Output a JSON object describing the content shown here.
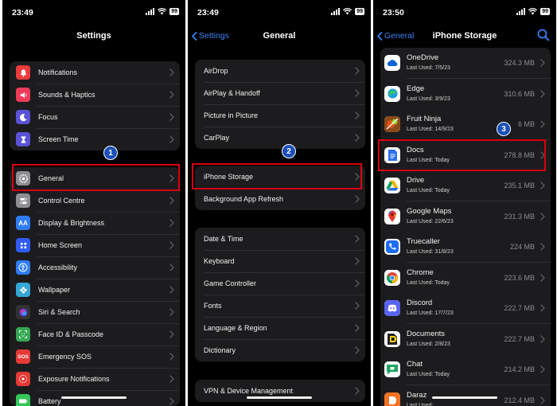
{
  "colors": {
    "accent": "#3a82f7",
    "highlight": "#d9000f",
    "badge": "#1b50b9"
  },
  "panel1": {
    "time": "23:49",
    "battery": "99",
    "title": "Settings",
    "group1": [
      {
        "label": "Notifications",
        "icon": "bell-icon",
        "color": "#ee3b3b"
      },
      {
        "label": "Sounds & Haptics",
        "icon": "speaker-icon",
        "color": "#ee3b5a"
      },
      {
        "label": "Focus",
        "icon": "moon-icon",
        "color": "#5a53d6"
      },
      {
        "label": "Screen Time",
        "icon": "hourglass-icon",
        "color": "#5a53d6"
      }
    ],
    "group2": [
      {
        "label": "General",
        "icon": "gear-icon",
        "color": "#8e8e93"
      },
      {
        "label": "Control Centre",
        "icon": "toggles-icon",
        "color": "#8e8e93"
      },
      {
        "label": "Display & Brightness",
        "icon": "aa-icon",
        "color": "#2f7cf6"
      },
      {
        "label": "Home Screen",
        "icon": "grid-icon",
        "color": "#2f5cf6"
      },
      {
        "label": "Accessibility",
        "icon": "accessibility-icon",
        "color": "#2f7cf6"
      },
      {
        "label": "Wallpaper",
        "icon": "flower-icon",
        "color": "#35a7d6"
      },
      {
        "label": "Siri & Search",
        "icon": "siri-icon",
        "color": "#333333"
      },
      {
        "label": "Face ID & Passcode",
        "icon": "face-id-icon",
        "color": "#34a853"
      },
      {
        "label": "Emergency SOS",
        "icon": "sos-icon",
        "color": "#e53935"
      },
      {
        "label": "Exposure Notifications",
        "icon": "exposure-icon",
        "color": "#e53935"
      },
      {
        "label": "Battery",
        "icon": "battery-icon",
        "color": "#34c759"
      }
    ],
    "step": "1"
  },
  "panel2": {
    "time": "23:49",
    "battery": "99",
    "back": "Settings",
    "title": "General",
    "group1": [
      "AirDrop",
      "AirPlay & Handoff",
      "Picture in Picture",
      "CarPlay"
    ],
    "group2": [
      "iPhone Storage",
      "Background App Refresh"
    ],
    "group3": [
      "Date & Time",
      "Keyboard",
      "Game Controller",
      "Fonts",
      "Language & Region",
      "Dictionary"
    ],
    "group4": [
      "VPN & Device Management"
    ],
    "step": "2"
  },
  "panel3": {
    "time": "23:50",
    "battery": "99",
    "back": "General",
    "title": "iPhone Storage",
    "apps": [
      {
        "name": "OneDrive",
        "last_used": "Last Used: 7/5/23",
        "size": "324.3 MB",
        "icon": "onedrive-icon"
      },
      {
        "name": "Edge",
        "last_used": "Last Used: 3/9/23",
        "size": "310.6 MB",
        "icon": "edge-icon"
      },
      {
        "name": "Fruit Ninja",
        "last_used": "Last Used: 14/9/23",
        "size": "6 MB",
        "icon": "fruit-ninja-icon"
      },
      {
        "name": "Docs",
        "last_used": "Last Used: Today",
        "size": "278.8 MB",
        "icon": "docs-icon"
      },
      {
        "name": "Drive",
        "last_used": "Last Used: Today",
        "size": "235.1 MB",
        "icon": "drive-icon"
      },
      {
        "name": "Google Maps",
        "last_used": "Last Used: 22/6/23",
        "size": "231.3 MB",
        "icon": "maps-icon"
      },
      {
        "name": "Truecaller",
        "last_used": "Last Used: 31/8/23",
        "size": "224 MB",
        "icon": "truecaller-icon"
      },
      {
        "name": "Chrome",
        "last_used": "Last Used: Today",
        "size": "223.6 MB",
        "icon": "chrome-icon"
      },
      {
        "name": "Discord",
        "last_used": "Last Used: 17/7/23",
        "size": "222.7 MB",
        "icon": "discord-icon"
      },
      {
        "name": "Documents",
        "last_used": "Last Used: 2/8/23",
        "size": "222.7 MB",
        "icon": "documents-icon"
      },
      {
        "name": "Chat",
        "last_used": "Last Used: Today",
        "size": "214.2 MB",
        "icon": "chat-icon"
      },
      {
        "name": "Daraz",
        "last_used": "Last Used:",
        "size": "212.4 MB",
        "icon": "daraz-icon"
      }
    ],
    "step": "3"
  }
}
